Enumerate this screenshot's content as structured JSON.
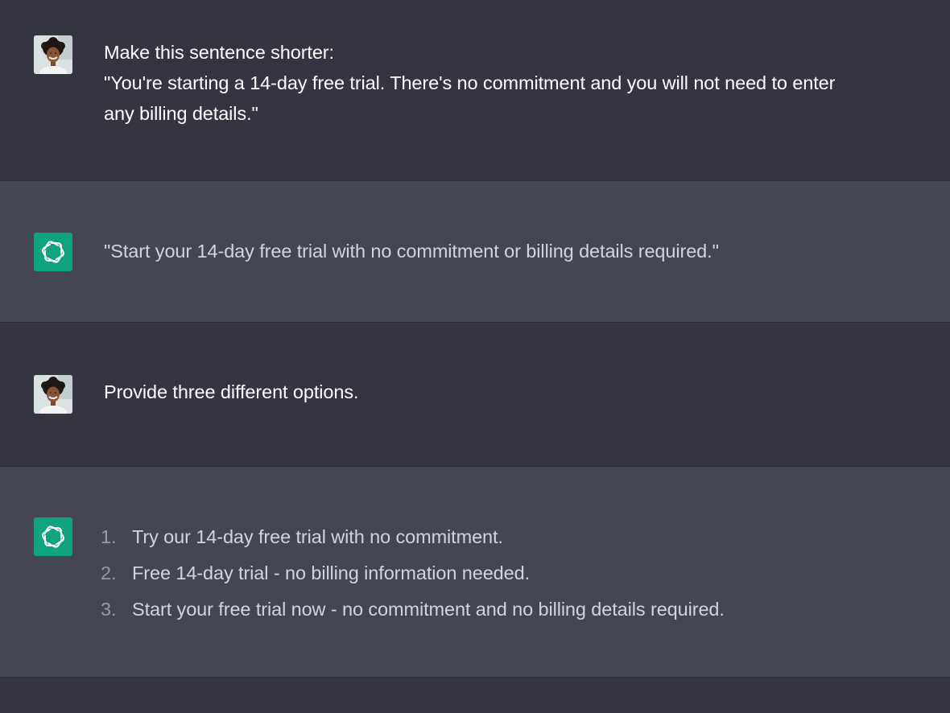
{
  "thread": {
    "messages": [
      {
        "role": "user",
        "avatar_icon": "user-photo-icon",
        "lines": [
          "Make this sentence shorter:",
          "\"You're starting a 14-day free trial. There's no commitment and you will not need to enter",
          "any billing details.\""
        ]
      },
      {
        "role": "assistant",
        "avatar_icon": "openai-logo-icon",
        "text": "\"Start your 14-day free trial with no commitment or billing details required.\""
      },
      {
        "role": "user",
        "avatar_icon": "user-photo-icon",
        "text": "Provide three different options."
      },
      {
        "role": "assistant",
        "avatar_icon": "openai-logo-icon",
        "list": [
          {
            "num": "1.",
            "text": "Try our 14-day free trial with no commitment."
          },
          {
            "num": "2.",
            "text": "Free 14-day trial - no billing information needed."
          },
          {
            "num": "3.",
            "text": "Start your free trial now - no commitment and no billing details required."
          }
        ]
      }
    ]
  },
  "colors": {
    "user_bg": "#343541",
    "assistant_bg": "#444654",
    "logo_bg": "#10a37f",
    "text": "#d1d5db"
  }
}
